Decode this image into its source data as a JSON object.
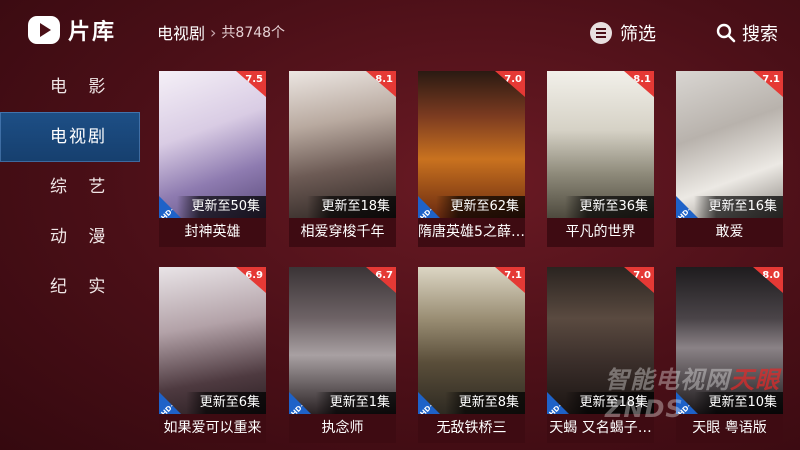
{
  "app": {
    "title": "片库"
  },
  "sidebar": {
    "items": [
      {
        "label": "电 影"
      },
      {
        "label": "电视剧",
        "active": true
      },
      {
        "label": "综 艺"
      },
      {
        "label": "动 漫"
      },
      {
        "label": "纪 实"
      }
    ]
  },
  "header": {
    "category": "电视剧",
    "count": "共8748个",
    "filter_label": "筛选",
    "search_label": "搜索"
  },
  "colors": {
    "accent": "#1d4f86",
    "rating_badge": "#e53935",
    "hd_badge": "#1e62c8",
    "background": "#4a0f17"
  },
  "cards": [
    {
      "title": "封神英雄",
      "rating": "7.5",
      "update": "更新至50集",
      "hd": "HD+"
    },
    {
      "title": "相爱穿梭千年",
      "rating": "8.1",
      "update": "更新至18集",
      "hd": ""
    },
    {
      "title": "隋唐英雄5之薛…",
      "rating": "7.0",
      "update": "更新至62集",
      "hd": "HD+"
    },
    {
      "title": "平凡的世界",
      "rating": "8.1",
      "update": "更新至36集",
      "hd": ""
    },
    {
      "title": "敢爱",
      "rating": "7.1",
      "update": "更新至16集",
      "hd": "HD+"
    },
    {
      "title": "如果爱可以重来",
      "rating": "6.9",
      "update": "更新至6集",
      "hd": "HD+"
    },
    {
      "title": "执念师",
      "rating": "6.7",
      "update": "更新至1集",
      "hd": "HD+"
    },
    {
      "title": "无敌铁桥三",
      "rating": "7.1",
      "update": "更新至8集",
      "hd": "HD+"
    },
    {
      "title": "天蝎 又名蝎子…",
      "rating": "7.0",
      "update": "更新至18集",
      "hd": "HD+"
    },
    {
      "title": "天眼 粤语版",
      "rating": "8.0",
      "update": "更新至10集",
      "hd": "HD+"
    }
  ],
  "watermark": {
    "prefix": "智能电视网",
    "brand": "天眼",
    "text": "ZNDS"
  }
}
